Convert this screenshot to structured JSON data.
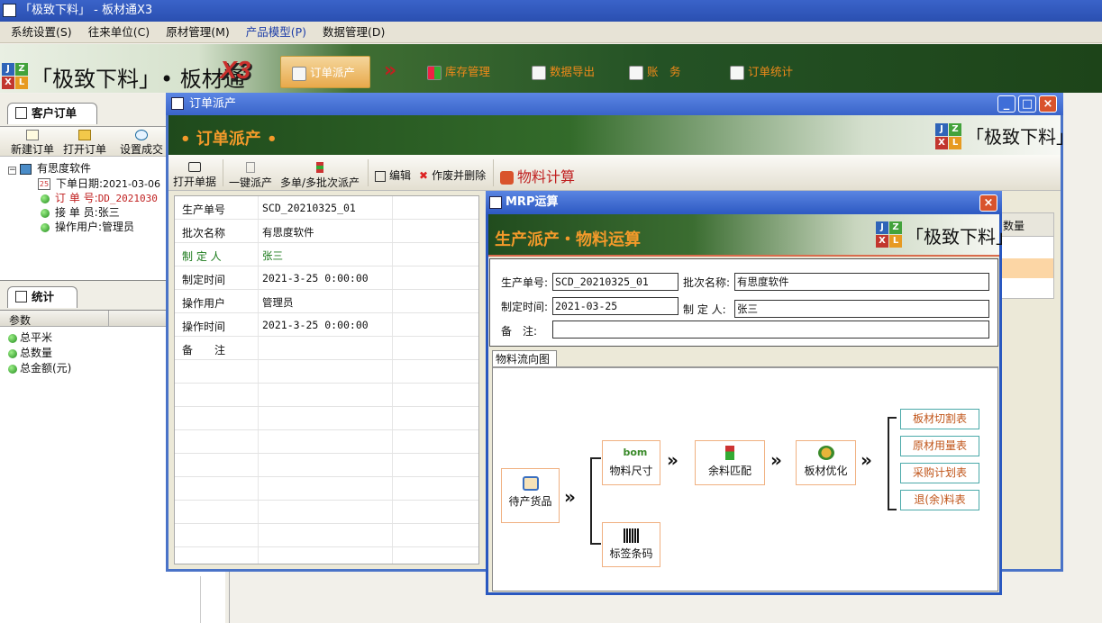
{
  "app": {
    "title": "「极致下料」 - 板材通X3"
  },
  "menu": [
    "系统设置(S)",
    "往来单位(C)",
    "原材管理(M)",
    "产品模型(P)",
    "数据管理(D)"
  ],
  "banner": {
    "brand": "「极致下料」• 板材通",
    "version": "X3",
    "nav": [
      "订单派产",
      "库存管理",
      "数据导出",
      "账　务",
      "订单统计"
    ],
    "logo_letters": [
      "J",
      "Z",
      "X",
      "L"
    ]
  },
  "left": {
    "orders_tab": "客户订单",
    "toolbar": [
      "新建订单",
      "打开订单",
      "设置成交"
    ],
    "tree": {
      "root": "有思度软件",
      "order_date_label": "下单日期:",
      "order_date": "2021-03-06",
      "order_no_label": "订 单 号:",
      "order_no": "DD_2021030",
      "receiver_label": "接 单 员:",
      "receiver": "张三",
      "operator_label": "操作用户:",
      "operator": "管理员"
    },
    "stats_tab": "统计",
    "stats_header": "参数",
    "stats_items": [
      "总平米",
      "总数量",
      "总金额(元)"
    ]
  },
  "order_window": {
    "title": "订单派产",
    "banner_title": "• 订单派产 •",
    "brand": "「极致下料」",
    "toolbar": {
      "open": "打开单据",
      "one_click": "一键派产",
      "multi": "多单/多批次派产",
      "edit": "编辑",
      "void_delete": "作废并删除",
      "material_calc": "物料计算"
    },
    "fields": [
      {
        "label": "生产单号",
        "value": "SCD_20210325_01"
      },
      {
        "label": "批次名称",
        "value": "有思度软件"
      },
      {
        "label": "制 定 人",
        "value": "张三"
      },
      {
        "label": "制定时间",
        "value": "2021-3-25 0:00:00"
      },
      {
        "label": "操作用户",
        "value": "管理员"
      },
      {
        "label": "操作时间",
        "value": "2021-3-25 0:00:00"
      },
      {
        "label": "备　　注",
        "value": ""
      }
    ],
    "grid_header": "数量"
  },
  "mrp_window": {
    "title": "MRP运算",
    "banner_title": "生产派产・物料运算",
    "brand": "「极致下料」",
    "form": {
      "prod_no_label": "生产单号:",
      "prod_no": "SCD_20210325_01",
      "batch_label": "批次名称:",
      "batch": "有思度软件",
      "time_label": "制定时间:",
      "time": "2021-03-25",
      "maker_label": "制 定 人:",
      "maker": "张三",
      "remark_label": "备　注:",
      "remark": ""
    },
    "tab": "物料流向图",
    "flow": {
      "start": "待产货品",
      "size": "物料尺寸",
      "barcode": "标签条码",
      "match": "余料匹配",
      "optimize": "板材优化",
      "outputs": [
        "板材切割表",
        "原材用量表",
        "采购计划表",
        "退(余)料表"
      ]
    }
  },
  "colors": {
    "title_bar": "#3a64c9",
    "accent_orange": "#f39a2a",
    "banner_green": "#245225",
    "output_text": "#c05418"
  }
}
